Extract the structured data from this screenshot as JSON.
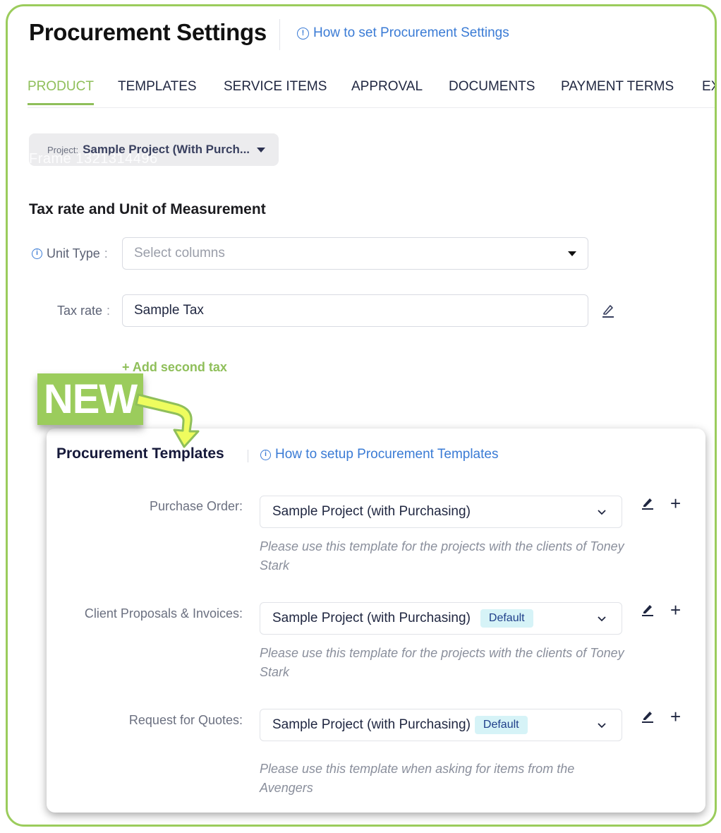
{
  "header": {
    "title": "Procurement Settings",
    "help_link": "How to set Procurement Settings"
  },
  "tabs": [
    {
      "label": "PRODUCT",
      "active": true
    },
    {
      "label": "TEMPLATES",
      "active": false
    },
    {
      "label": "SERVICE ITEMS",
      "active": false
    },
    {
      "label": "APPROVAL",
      "active": false
    },
    {
      "label": "DOCUMENTS",
      "active": false
    },
    {
      "label": "PAYMENT TERMS",
      "active": false
    },
    {
      "label": "EXC",
      "active": false
    }
  ],
  "project_selector": {
    "label": "Project:",
    "value": "Sample Project (With Purch...",
    "ghost_text": "Frame 1321314496"
  },
  "tax_section": {
    "heading": "Tax rate and Unit of Measurement",
    "unit_type": {
      "label": "Unit Type",
      "placeholder": "Select columns"
    },
    "tax_rate": {
      "label": "Tax rate",
      "value": "Sample Tax"
    },
    "add_second_tax": "+ Add second tax"
  },
  "new_badge": "NEW",
  "templates_card": {
    "title": "Procurement Templates",
    "help_link": "How to setup Procurement Templates",
    "rows": [
      {
        "label": "Purchase Order:",
        "value": "Sample Project (with Purchasing)",
        "badge": null,
        "description": "Please use this template for the  projects with the clients of Toney Stark"
      },
      {
        "label": "Client Proposals & Invoices:",
        "value": "Sample Project (with Purchasing)",
        "badge": "Default",
        "description": "Please use this template for the  projects with the clients of Toney Stark"
      },
      {
        "label": "Request for Quotes:",
        "value": "Sample Project (with Purchasing)",
        "badge": "Default",
        "description": "Please use this template when asking for items from the Avengers"
      }
    ]
  },
  "colors": {
    "accent_green": "#9bcc5c",
    "link_blue": "#3a7bd5",
    "badge_bg": "#d6f3f7",
    "arrow_yellow": "#eefc5e"
  }
}
